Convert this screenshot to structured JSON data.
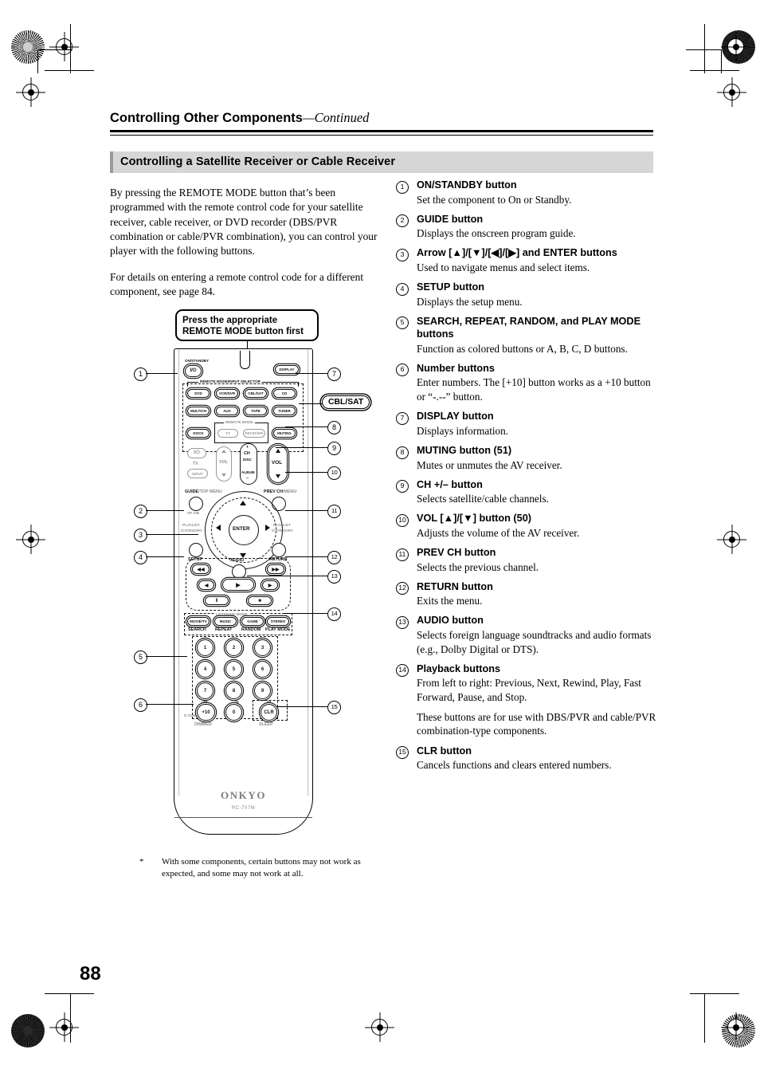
{
  "header": {
    "title": "Controlling Other Components",
    "continued": "—Continued",
    "section_heading": "Controlling a Satellite Receiver or Cable Receiver"
  },
  "intro": {
    "paragraph1": "By pressing the REMOTE MODE button that’s been programmed with the remote control code for your satellite receiver, cable receiver, or DVD recorder (DBS/PVR combination or cable/PVR combination), you can control your player with the following buttons.",
    "paragraph2": "For details on entering a remote control code for a different component, see page 84."
  },
  "callout": {
    "line1": "Press the appropriate",
    "line2": "REMOTE MODE button first",
    "emphasis_badge": "CBL/SAT"
  },
  "items": [
    {
      "n": "1",
      "heading": "ON/STANDBY button",
      "body": "Set the component to On or Standby."
    },
    {
      "n": "2",
      "heading": "GUIDE button",
      "body": "Displays the onscreen program guide."
    },
    {
      "n": "3",
      "heading": "Arrow [▲]/[▼]/[◀]/[▶] and ENTER buttons",
      "body": "Used to navigate menus and select items."
    },
    {
      "n": "4",
      "heading": "SETUP button",
      "body": "Displays the setup menu."
    },
    {
      "n": "5",
      "heading": "SEARCH, REPEAT, RANDOM, and PLAY MODE buttons",
      "body": "Function as colored buttons or A, B, C, D buttons."
    },
    {
      "n": "6",
      "heading": "Number buttons",
      "body": "Enter numbers. The [+10] button works as a +10 button or “-.--” button."
    },
    {
      "n": "7",
      "heading": "DISPLAY button",
      "body": "Displays information."
    },
    {
      "n": "8",
      "heading": "MUTING button (51)",
      "body": "Mutes or unmutes the AV receiver."
    },
    {
      "n": "9",
      "heading": "CH +/– button",
      "body": "Selects satellite/cable channels."
    },
    {
      "n": "10",
      "heading": "VOL [▲]/[▼] button (50)",
      "body": "Adjusts the volume of the AV receiver."
    },
    {
      "n": "11",
      "heading": "PREV CH button",
      "body": "Selects the previous channel."
    },
    {
      "n": "12",
      "heading": "RETURN button",
      "body": "Exits the menu."
    },
    {
      "n": "13",
      "heading": "AUDIO button",
      "body": "Selects foreign language soundtracks and audio formats (e.g., Dolby Digital or DTS)."
    },
    {
      "n": "14",
      "heading": "Playback buttons",
      "body": "From left to right: Previous, Next, Rewind, Play, Fast Forward, Pause, and Stop.",
      "body2": "These buttons are for use with DBS/PVR and cable/PVR combination-type components."
    },
    {
      "n": "15",
      "heading": "CLR button",
      "body": "Cancels functions and clears entered numbers."
    }
  ],
  "remote": {
    "brand": "ONKYO",
    "model": "RC-707M",
    "on_standby_label": "ON/STANDBY",
    "on_standby_glyph": "I/⏻",
    "display_button": "DISPLAY",
    "selector_group_label": "REMOTE MODE/INPUT SELECTOR",
    "selector_buttons": [
      "DVD",
      "VCR/DVR",
      "CBL/SAT",
      "CD",
      "MULTICH",
      "AUX",
      "TAPE",
      "TUNER",
      "DOCK"
    ],
    "remote_mode_group_label": "REMOTE MODE",
    "remote_mode_buttons": [
      "TV",
      "RECEIVER"
    ],
    "muting_button": "MUTING",
    "tv_power_glyph": "I/⏻",
    "tv_label": "TV",
    "input_button": "INPUT",
    "tv_vol_label": "VOL",
    "ch_label": "CH",
    "disc_label": "DISC",
    "album_label": "ALBUM",
    "vol_label": "VOL",
    "guide_label": "GUIDE",
    "top_menu_label": "/TOP MENU",
    "sp_ab_label": "SP A/B",
    "prev_ch_label": "PREV CH",
    "menu_label": "/MENU",
    "playlist_label": "PLAYLIST",
    "category_label": "/CATEGORY",
    "enter_label": "ENTER",
    "setup_label": "SETUP",
    "return_label": "RETURN",
    "audio_label": "AUDIO",
    "listening_mode_label": "LISTENING MODE",
    "listening_buttons": [
      "MOVIE/TV",
      "MUSIC",
      "GAME",
      "STEREO"
    ],
    "listening_sublabels": [
      "SEARCH",
      "REPEAT",
      "RANDOM",
      "PLAY MODE"
    ],
    "number_buttons": [
      "1",
      "2",
      "3",
      "4",
      "5",
      "6",
      "7",
      "8",
      "9",
      "+10",
      "0"
    ],
    "plus10_over": "--10",
    "zero_over": "11",
    "clr_over": "12",
    "dimmer_label": "DIMMER",
    "dtun_label": "D.TUN",
    "sleep_label": "SLEEP",
    "clr_button": "CLR",
    "playback_glyphs": [
      "◀◀",
      "▶▶",
      "◀",
      "▶",
      "▶",
      "‖",
      "■"
    ]
  },
  "footnote": {
    "asterisk": "*",
    "text": "With some components, certain buttons may not work as expected, and some may not work at all."
  },
  "page_number": "88"
}
